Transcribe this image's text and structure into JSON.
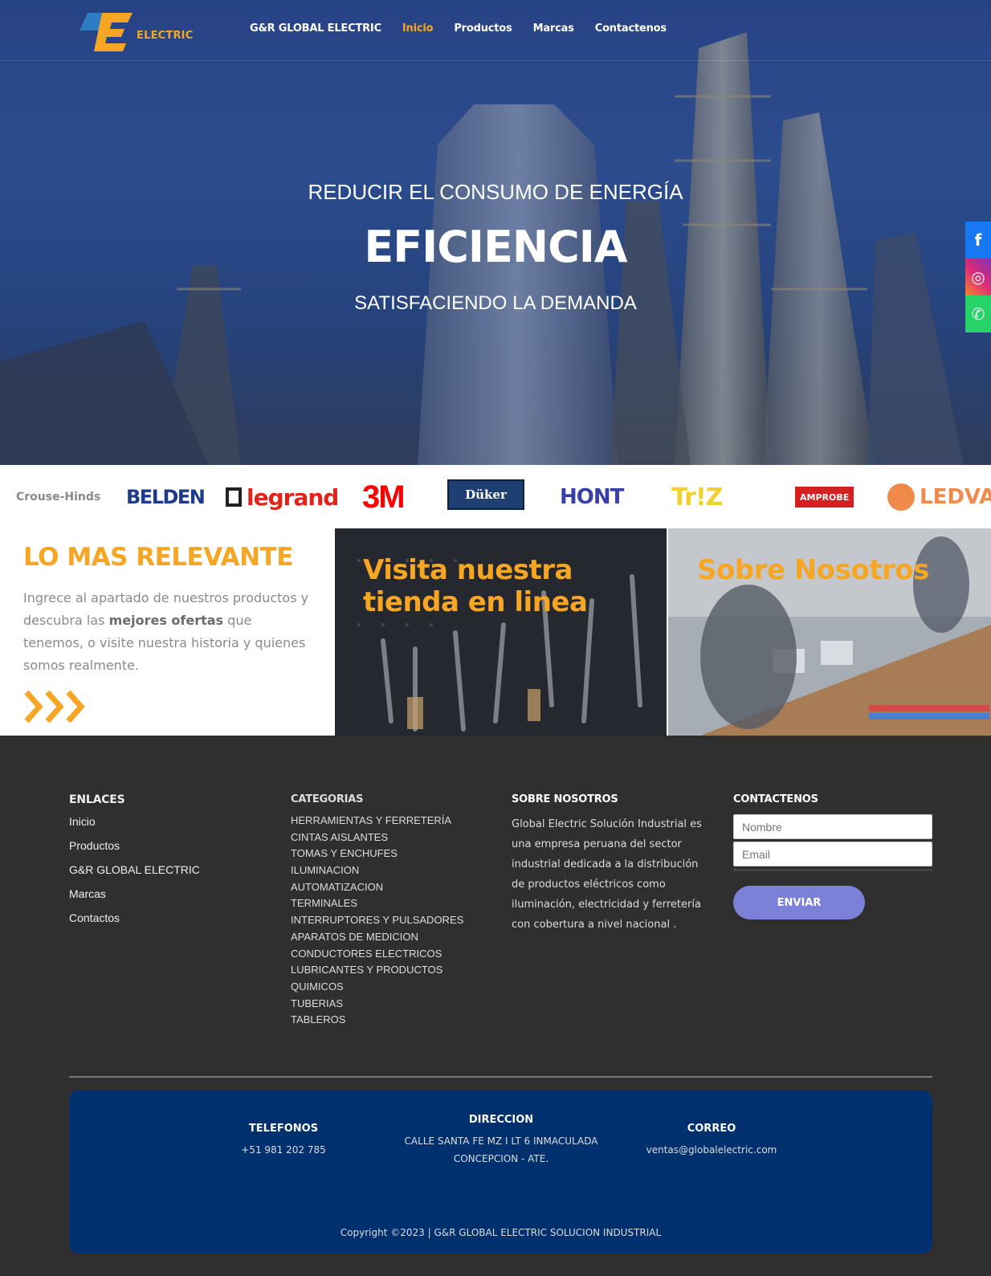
{
  "nav": {
    "logo_text": "ELECTRIC",
    "items": [
      {
        "label": "G&R GLOBAL ELECTRIC",
        "active": false
      },
      {
        "label": "Inicio",
        "active": true
      },
      {
        "label": "Productos",
        "active": false
      },
      {
        "label": "Marcas",
        "active": false
      },
      {
        "label": "Contactenos",
        "active": false
      }
    ]
  },
  "hero": {
    "line1": "REDUCIR EL CONSUMO DE ENERGÍA",
    "title": "EFICIENCIA",
    "line2": "SATISFACIENDO LA DEMANDA"
  },
  "social": {
    "facebook": "f",
    "instagram": "◎",
    "whatsapp": "✆"
  },
  "brands": [
    "Crouse-Hinds",
    "BELDEN",
    "legrand",
    "3M",
    "Düker",
    "HONT",
    "Tr!Z",
    "AMPROBE",
    "LEDVANC"
  ],
  "promo": {
    "title": "LO MAS RELEVANTE",
    "body_before": "Ingrece al apartado de nuestros productos y descubra las ",
    "body_bold": "mejores ofertas",
    "body_after": " que tenemos, o visite nuestra historia y quienes somos realmente.",
    "tile1_title": "Visita nuestra tienda en linea",
    "tile2_title": "Sobre Nosotros"
  },
  "footer": {
    "links_head": "ENLACES",
    "links": [
      "Inicio",
      "Productos",
      "G&R GLOBAL ELECTRIC",
      "Marcas",
      "Contactos"
    ],
    "cats_head": "CATEGORIAS",
    "cats": [
      "HERRAMIENTAS Y FERRETERÍA",
      "CINTAS AISLANTES",
      "TOMAS Y ENCHUFES",
      "ILUMINACION",
      "AUTOMATIZACION",
      "TERMINALES",
      "INTERRUPTORES Y PULSADORES",
      "APARATOS DE MEDICION",
      "CONDUCTORES ELECTRICOS",
      "LUBRICANTES Y PRODUCTOS",
      "QUIMICOS",
      "TUBERIAS",
      "TABLEROS"
    ],
    "about_head": "SOBRE NOSOTROS",
    "about_text": "Global Electric Solución Industrial es una empresa peruana del sector industrial dedicada a la distribución de productos eléctricos como iluminación, electricidad y ferretería con cobertura a nivel nacional .",
    "contact_head": "CONTACTENOS",
    "name_placeholder": "Nombre",
    "email_placeholder": "Email",
    "send_label": "ENVIAR"
  },
  "contact_box": {
    "phones_head": "TELEFONOS",
    "phone": "+51 981 202 785",
    "address_head": "DIRECCION",
    "address_line1": "CALLE SANTA FE MZ I LT 6 INMACULADA",
    "address_line2": "CONCEPCION - ATE.",
    "email_head": "CORREO",
    "email": "ventas@globalelectric.com",
    "copyright": "Copyright ©2023 | G&R GLOBAL ELECTRIC SOLUCION INDUSTRIAL"
  }
}
